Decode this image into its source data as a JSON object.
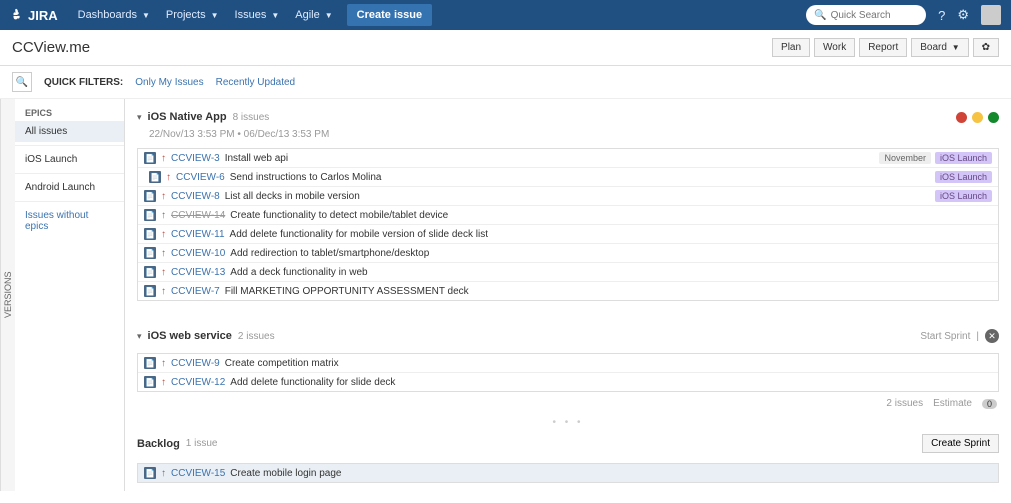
{
  "topbar": {
    "logo": "JIRA",
    "nav": [
      "Dashboards",
      "Projects",
      "Issues",
      "Agile"
    ],
    "create": "Create issue",
    "search_placeholder": "Quick Search"
  },
  "subhead": {
    "title": "CCView.me",
    "buttons": [
      "Plan",
      "Work",
      "Report",
      "Board"
    ],
    "gear": "⚙"
  },
  "filters": {
    "label": "QUICK FILTERS:",
    "links": [
      "Only My Issues",
      "Recently Updated"
    ]
  },
  "vtab": "VERSIONS",
  "sidebar": {
    "head": "EPICS",
    "items": [
      "All issues",
      "iOS Launch",
      "Android Launch"
    ],
    "link": "Issues without epics"
  },
  "sections": [
    {
      "title": "iOS Native App",
      "count": "8 issues",
      "dates": "22/Nov/13 3:53 PM • 06/Dec/13 3:53 PM",
      "lights": [
        "#d04437",
        "#f6c342",
        "#14892c"
      ],
      "issues": [
        {
          "key": "CCVIEW-3",
          "summary": "Install web api",
          "tags": [
            {
              "t": "November",
              "c": "grey"
            },
            {
              "t": "iOS Launch",
              "c": "purple"
            }
          ]
        },
        {
          "key": "CCVIEW-6",
          "summary": "Send instructions to Carlos Molina",
          "flag": true,
          "tags": [
            {
              "t": "iOS Launch",
              "c": "purple"
            }
          ]
        },
        {
          "key": "CCVIEW-8",
          "summary": "List all decks in mobile version",
          "tags": [
            {
              "t": "iOS Launch",
              "c": "purple"
            }
          ]
        },
        {
          "key": "CCVIEW-14",
          "summary": "Create functionality to detect mobile/tablet device",
          "strike": true
        },
        {
          "key": "CCVIEW-11",
          "summary": "Add delete functionality for mobile version of slide deck list"
        },
        {
          "key": "CCVIEW-10",
          "summary": "Add redirection to tablet/smartphone/desktop"
        },
        {
          "key": "CCVIEW-13",
          "summary": "Add a deck functionality in web"
        },
        {
          "key": "CCVIEW-7",
          "summary": "Fill MARKETING OPPORTUNITY ASSESSMENT deck"
        }
      ]
    },
    {
      "title": "iOS web service",
      "count": "2 issues",
      "actions": {
        "start": "Start Sprint"
      },
      "issues": [
        {
          "key": "CCVIEW-9",
          "summary": "Create competition matrix"
        },
        {
          "key": "CCVIEW-12",
          "summary": "Add delete functionality for slide deck"
        }
      ],
      "footer": {
        "count": "2 issues",
        "est_label": "Estimate",
        "est_val": "0"
      }
    }
  ],
  "backlog": {
    "title": "Backlog",
    "count": "1 issue",
    "create_sprint": "Create Sprint",
    "issues": [
      {
        "key": "CCVIEW-15",
        "summary": "Create mobile login page",
        "selected": true
      }
    ]
  }
}
